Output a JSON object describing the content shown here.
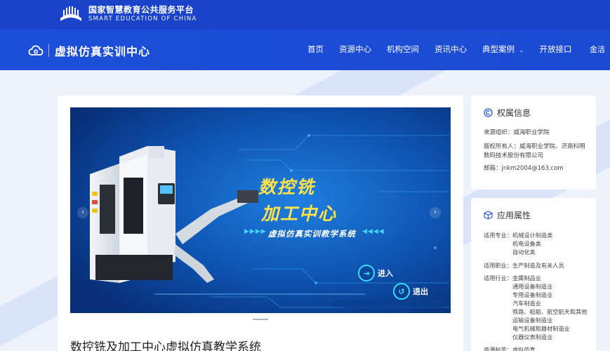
{
  "platform": {
    "name_cn": "国家智慧教育公共服务平台",
    "name_en": "SMART EDUCATION OF CHINA"
  },
  "site": {
    "title": "虚拟仿真实训中心"
  },
  "nav": {
    "items": [
      {
        "label": "首页"
      },
      {
        "label": "资源中心"
      },
      {
        "label": "机构空间"
      },
      {
        "label": "资讯中心"
      },
      {
        "label": "典型案例",
        "has_dropdown": true
      },
      {
        "label": "开放接口"
      }
    ],
    "user": "金洁"
  },
  "banner": {
    "headline_1": "数控铣",
    "headline_2": "加工中心",
    "subline": "虚拟仿真实训教学系统",
    "arrows_left": "▶▶▶▶",
    "arrows_right": "◀◀◀◀",
    "enter_label": "进入",
    "exit_label": "退出",
    "prev_icon": "chevron-left-icon",
    "next_icon": "chevron-right-icon"
  },
  "main": {
    "title": "数控铣及加工中心虚拟仿真教学系统"
  },
  "rights": {
    "heading": "权属信息",
    "source": "来源组织：威海职业学院",
    "owner": "版权所有人：威海职业学院、济南科明数码技术股份有限公司",
    "email": "邮箱：jnkm2004@163.com"
  },
  "attributes": {
    "heading": "应用属性",
    "major_label": "适用专业：",
    "majors": [
      "机械设计制造类",
      "机电设备类",
      "自动化类"
    ],
    "job_label": "适用职业：",
    "jobs": [
      "生产制造及有关人员"
    ],
    "industry_label": "适用行业：",
    "industries": [
      "金属制品业",
      "通用设备制造业",
      "专用设备制造业",
      "汽车制造业",
      "铁路、船舶、航空航天和其他运输设备制造业",
      "电气机械和器材制造业",
      "仪器仪表制造业"
    ],
    "tag_label": "资源标签：",
    "tags": [
      "虚拟仿真"
    ]
  },
  "colors": {
    "brand_blue": "#1a43c9",
    "nav_blue": "#1d4fd8",
    "banner_title": "#ffe24a",
    "accent_cyan": "#33e0ff"
  }
}
